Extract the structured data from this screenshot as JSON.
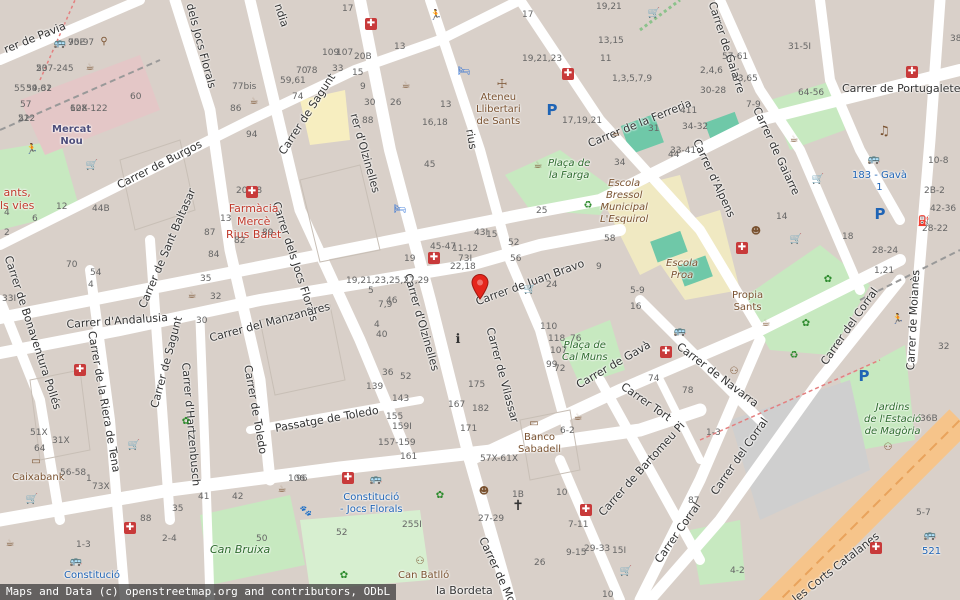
{
  "map": {
    "marker": {
      "type": "red-map-pin"
    },
    "attribution": "Maps and Data (c) openstreetmap.org and contributors, ODbL",
    "streets": [
      {
        "id": "carrer-de-pavia",
        "text": "rer de Pavia"
      },
      {
        "id": "carrer-dels-jocs-florals-top",
        "text": "dels Jocs Florals"
      },
      {
        "id": "landia",
        "text": "ndia"
      },
      {
        "id": "carrer-de-burgos",
        "text": "Carrer de Burgos"
      },
      {
        "id": "carrer-de-sagunt-top",
        "text": "Carrer de Sagunt"
      },
      {
        "id": "carrer-dels-jocs-florals-mid",
        "text": "Carrer dels Jocs Florals"
      },
      {
        "id": "carrer-dolzinelles-top",
        "text": "rer d'Olzinelles"
      },
      {
        "id": "rius",
        "text": "rius"
      },
      {
        "id": "carrer-de-la-ferreria",
        "text": "Carrer de la Ferreria"
      },
      {
        "id": "carrer-de-gaiarre-top",
        "text": "Carrer de Gaiarre"
      },
      {
        "id": "carrer-de-portugalete",
        "text": "Carrer de Portugalete"
      },
      {
        "id": "carrer-dalpens",
        "text": "Carrer d'Alpens"
      },
      {
        "id": "carrer-de-gaiarre",
        "text": "Carrer de Gaiarre"
      },
      {
        "id": "carrer-de-sant-baltasar",
        "text": "Carrer de Sant Baltasar"
      },
      {
        "id": "carrer-de-bonaventura-polles",
        "text": "Carrer de Bonaventura Pollés"
      },
      {
        "id": "carrer-dandalusia",
        "text": "Carrer d'Andalusia"
      },
      {
        "id": "carrer-del-manzanares",
        "text": "Carrer del Manzanares"
      },
      {
        "id": "carrer-de-juan-bravo",
        "text": "Carrer de Juan Bravo"
      },
      {
        "id": "carrer-dolzinelles-mid",
        "text": "Carrer d'Olzinelles"
      },
      {
        "id": "carrer-de-vilassar",
        "text": "Carrer de Vilassar"
      },
      {
        "id": "carrer-de-la-riera-de-tena",
        "text": "Carrer de la Riera de Tena"
      },
      {
        "id": "carrer-de-sagunt-bottom",
        "text": "Carrer de Sagunt"
      },
      {
        "id": "carrer-dhartzenbusch",
        "text": "Carrer d'Hartzenbusch"
      },
      {
        "id": "carrer-de-toledo",
        "text": "Carrer de Toledo"
      },
      {
        "id": "passatge-de-toledo",
        "text": "Passatge de Toledo"
      },
      {
        "id": "carrer-de-gava",
        "text": "Carrer de Gavà"
      },
      {
        "id": "carrer-de-navarra",
        "text": "Carrer de Navarra"
      },
      {
        "id": "carrer-del-corral-right",
        "text": "Carrer del Corral"
      },
      {
        "id": "carrer-del-corral-bottom",
        "text": "Carrer del Corral"
      },
      {
        "id": "carrer-tort",
        "text": "Carrer Tort"
      },
      {
        "id": "carrer-de-bartomeu-pi",
        "text": "Carrer de Bartomeu Pi"
      },
      {
        "id": "carrer-corral",
        "text": "Carrer Corral"
      },
      {
        "id": "carrer-de-mos",
        "text": "Carrer de Mos"
      },
      {
        "id": "carrer-de-moianes",
        "text": "Carrer de Moianès"
      },
      {
        "id": "les-corts-catalanes",
        "text": "les Corts Catalanes"
      },
      {
        "id": "la-bordeta",
        "text": "la Bordeta"
      }
    ],
    "pois": [
      {
        "id": "mercat-nou",
        "text": "Mercat\nNou",
        "style": "dark"
      },
      {
        "id": "farmacia-merce-rius-balet",
        "text": "Farmàcia\nMercè\nRius Balet",
        "style": "red"
      },
      {
        "id": "ateneu-llibertari",
        "text": "Ateneu\nLlibertari\nde Sants",
        "style": "brown"
      },
      {
        "id": "placa-de-la-farga",
        "text": "Plaça de\nla Farga",
        "style": "green"
      },
      {
        "id": "escola-bressol",
        "text": "Escola\nBressol\nMunicipal\nL'Esquirol",
        "style": "brown"
      },
      {
        "id": "escola-proa",
        "text": "Escola\nProa",
        "style": "brown"
      },
      {
        "id": "propia-sants",
        "text": "Propia\nSants",
        "style": "brown"
      },
      {
        "id": "placa-de-cal-muns",
        "text": "Plaça de\nCal Muns",
        "style": "green"
      },
      {
        "id": "banco-sabadell",
        "text": "Banco\nSabadell",
        "style": "brown"
      },
      {
        "id": "caixabank",
        "text": "Caixabank",
        "style": "brown"
      },
      {
        "id": "constitucio-jocs-florals",
        "text": "Constitució\n- Jocs Florals",
        "style": "blue"
      },
      {
        "id": "can-bruixa",
        "text": "Can Bruixa",
        "style": "green"
      },
      {
        "id": "can-batllo",
        "text": "Can Batlló",
        "style": "brown"
      },
      {
        "id": "jardins-estacio-magoria",
        "text": "Jardins\nde l'Estació\nde Magòria",
        "style": "green"
      },
      {
        "id": "bus-183-gava",
        "text": "183 - Gavà\n1",
        "style": "blue"
      },
      {
        "id": "bus-521",
        "text": "521",
        "style": "blue"
      },
      {
        "id": "constitucio-bottom",
        "text": "Constitució",
        "style": "blue"
      },
      {
        "id": "sants-els-vies",
        "text": "ants,\nls vies",
        "style": "red"
      }
    ],
    "house_numbers": [
      "70E",
      "60X",
      "53",
      "51",
      "59,61",
      "57",
      "55",
      "17",
      "19,21",
      "13",
      "13,15",
      "11",
      "107",
      "109",
      "20B",
      "15",
      "17",
      "33",
      "9",
      "19,21,23",
      "1,3,5,7,9",
      "2,4,6",
      "57-61",
      "63,65",
      "31-5I",
      "64-56",
      "44",
      "12",
      "44B",
      "4",
      "6",
      "2",
      "60",
      "77bis",
      "59,61",
      "86",
      "94",
      "74",
      "70",
      "78",
      "88",
      "30",
      "26",
      "13",
      "16,18",
      "17,19,21",
      "31",
      "411",
      "34-32",
      "30-28",
      "7-9",
      "34",
      "33-41",
      "45",
      "43I",
      "25",
      "11-12",
      "22,18",
      "15",
      "73I",
      "52",
      "56",
      "58",
      "45-47",
      "19",
      "9",
      "24",
      "14",
      "18",
      "28-24",
      "1,21",
      "10-8",
      "2B-2",
      "42-36",
      "28-22",
      "20-18",
      "13",
      "89",
      "87",
      "82",
      "84",
      "70",
      "54",
      "4",
      "33I",
      "35",
      "32",
      "30",
      "19,21,23,25,27,29",
      "5",
      "46",
      "7,9",
      "4",
      "40",
      "36",
      "52",
      "139",
      "143",
      "155",
      "159I",
      "157-159",
      "161",
      "167",
      "171",
      "182",
      "175",
      "110",
      "118",
      "107",
      "99",
      "72",
      "76",
      "74",
      "78",
      "57X-61X",
      "1-3",
      "1B",
      "6-2",
      "10",
      "7-11",
      "9-15",
      "15I",
      "87",
      "27-29",
      "26",
      "29-33",
      "5-9",
      "16",
      "38",
      "36B",
      "32",
      "35",
      "41",
      "42",
      "50",
      "52",
      "255I",
      "106",
      "96",
      "88",
      "73X",
      "51X",
      "31X",
      "64",
      "56-58",
      "1",
      "2-4",
      "1-3",
      "4-2",
      "5-7",
      "10",
      "95-97",
      "128-122",
      "207-245",
      "222",
      "34-32"
    ]
  }
}
